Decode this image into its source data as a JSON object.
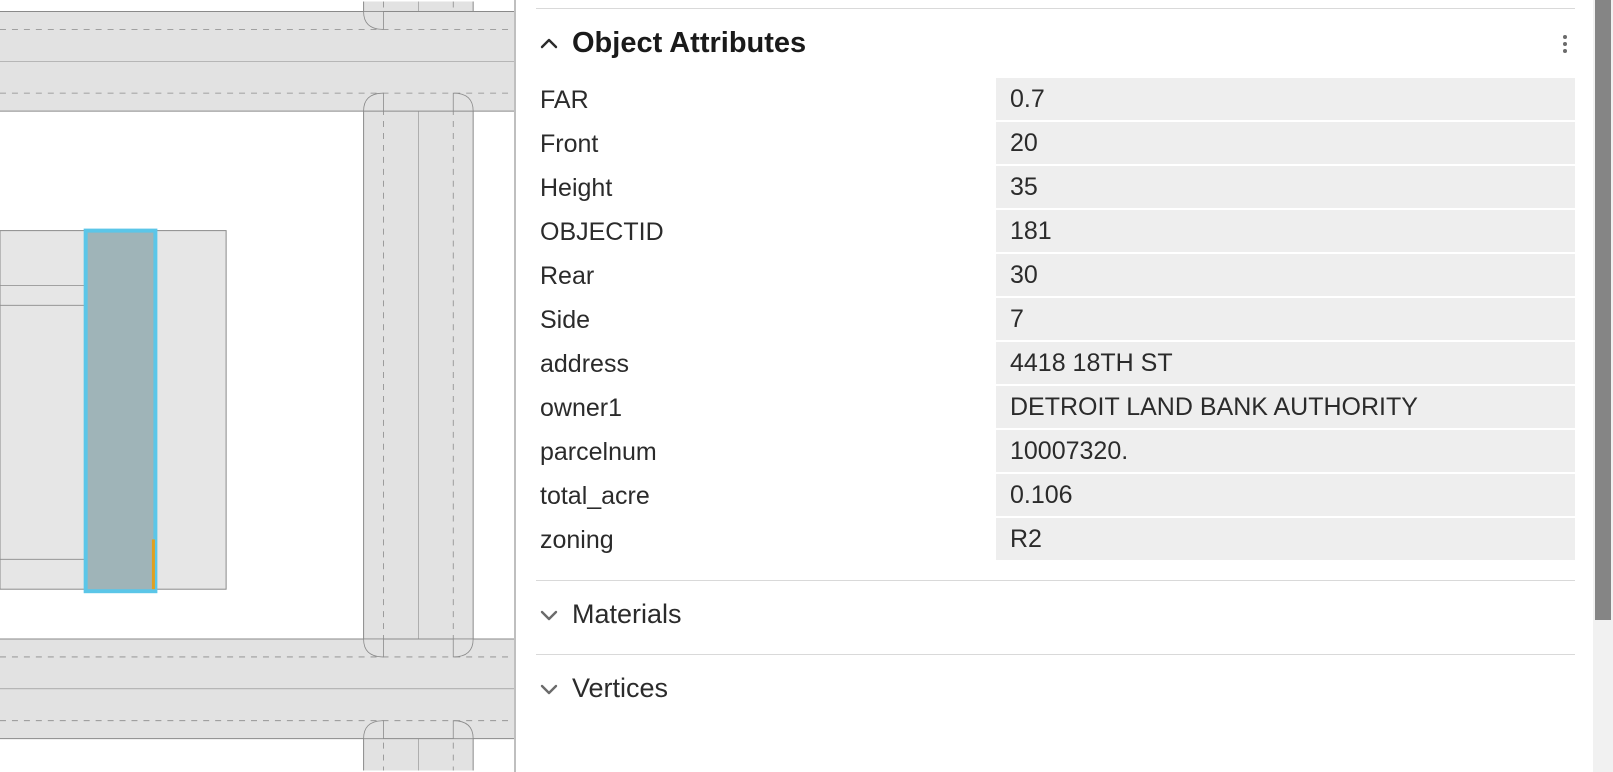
{
  "sections": {
    "object_attributes": {
      "title": "Object Attributes",
      "expanded": true,
      "rows": [
        {
          "label": "FAR",
          "value": "0.7"
        },
        {
          "label": "Front",
          "value": "20"
        },
        {
          "label": "Height",
          "value": "35"
        },
        {
          "label": "OBJECTID",
          "value": "181"
        },
        {
          "label": "Rear",
          "value": "30"
        },
        {
          "label": "Side",
          "value": "7"
        },
        {
          "label": "address",
          "value": "4418 18TH ST"
        },
        {
          "label": "owner1",
          "value": "DETROIT LAND BANK AUTHORITY"
        },
        {
          "label": "parcelnum",
          "value": "10007320."
        },
        {
          "label": "total_acre",
          "value": "0.106"
        },
        {
          "label": "zoning",
          "value": "R2"
        }
      ]
    },
    "materials": {
      "title": "Materials",
      "expanded": false
    },
    "vertices": {
      "title": "Vertices",
      "expanded": false
    }
  },
  "viewport": {
    "selected_parcel_color": "#5bc6e8",
    "selected_parcel_fill": "#9fb4b8",
    "street_fill": "#e2e2e2",
    "street_edge": "#8a8a8a"
  }
}
